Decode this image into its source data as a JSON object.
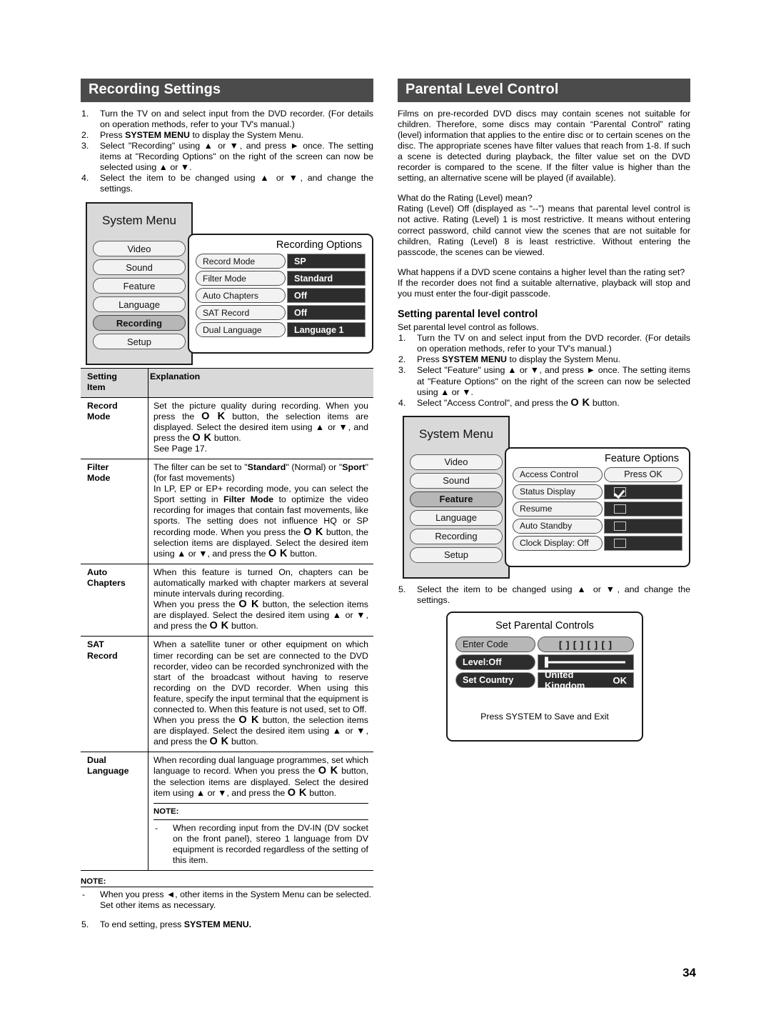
{
  "page_number": "34",
  "left": {
    "section_title": "Recording Settings",
    "steps": [
      {
        "num": "1.",
        "html": "Turn the TV on and select input from the DVD recorder. (For details on operation methods, refer to your TV's manual.)"
      },
      {
        "num": "2.",
        "html": "Press <b>SYSTEM MENU</b> to display the System Menu."
      },
      {
        "num": "3.",
        "html": "Select \"Recording\" using <b>▲</b> or <b>▼</b>, and press <b>►</b> once. The setting items at \"Recording Options\" on the right of the screen can now be selected using <b>▲</b> or <b>▼</b>."
      },
      {
        "num": "4.",
        "html": "Select the item to be changed using <b>▲</b> or <b>▼</b>, and change the settings."
      }
    ],
    "system_menu": {
      "title": "System Menu",
      "items": [
        "Video",
        "Sound",
        "Feature",
        "Language",
        "Recording",
        "Setup"
      ],
      "selected": "Recording"
    },
    "options_panel": {
      "title": "Recording Options",
      "rows": [
        {
          "label": "Record Mode",
          "value": "SP"
        },
        {
          "label": "Filter Mode",
          "value": "Standard"
        },
        {
          "label": "Auto Chapters",
          "value": "Off"
        },
        {
          "label": "SAT Record",
          "value": "Off"
        },
        {
          "label": "Dual Language",
          "value": "Language 1"
        }
      ]
    },
    "table": {
      "headers": [
        "Setting\nItem",
        "Explanation"
      ],
      "header_col1_line1": "Setting",
      "header_col1_line2": "Item",
      "header_col2": "Explanation",
      "rows": [
        {
          "item_line1": "Record",
          "item_line2": "Mode",
          "explanation_html": "Set the picture quality during recording. When you press the <span class=\"okglyph\">O K</span> button, the selection items are displayed. Select the desired item using <b>▲</b> or <b>▼</b>, and press the <span class=\"okglyph\">O K</span> button.<br>See Page 17."
        },
        {
          "item_line1": "Filter",
          "item_line2": "Mode",
          "explanation_html": "The filter can be set to \"<b>Standard</b>\" (Normal) or \"<b>Sport</b>\" (for fast movements)<br>In LP, EP or EP+ recording mode, you can select the Sport setting in <b>Filter Mode</b> to optimize the video recording for images that contain fast movements, like sports. The setting does not influence HQ or SP recording mode. When you press the <span class=\"okglyph\">O K</span> button, the selection items are displayed. Select the desired item using <b>▲</b> or <b>▼</b>, and press the <span class=\"okglyph\">O K</span> button."
        },
        {
          "item_line1": "Auto",
          "item_line2": "Chapters",
          "explanation_html": "When this feature is turned On, chapters can be automatically marked with chapter markers at several minute intervals during recording.<br>When you press the <span class=\"okglyph\">O K</span> button, the selection items are displayed. Select the desired item using <b>▲</b> or <b>▼</b>, and press the <span class=\"okglyph\">O K</span> button."
        },
        {
          "item_line1": "SAT",
          "item_line2": "Record",
          "explanation_html": "When a satellite tuner or other equipment on which timer recording can be set are connected to the DVD recorder, video can be recorded synchronized with the start of the broadcast without having to reserve recording on the DVD recorder. When using this feature, specify the input terminal that the equipment is connected to. When this feature is not used, set to Off.<br>When you press the <span class=\"okglyph\">O K</span> button, the selection items are displayed. Select the desired item using <b>▲</b> or <b>▼</b>, and press the <span class=\"okglyph\">O K</span> button."
        },
        {
          "item_line1": "Dual",
          "item_line2": "Language",
          "explanation_html": "When recording dual language programmes, set which language to record. When you press the <span class=\"okglyph\">O K</span> button, the selection items are displayed. Select the desired item using <b>▲</b> or <b>▼</b>, and press the <span class=\"okglyph\">O K</span> button.",
          "note_label": "NOTE:",
          "note_dash": "-",
          "note_text": "When recording input from the DV-IN (DV socket on the front panel), stereo 1 language from DV equipment is recorded regardless of the setting of this item."
        }
      ]
    },
    "bottom_note": {
      "label": "NOTE:",
      "dash": "-",
      "text_html": "When you press <b>◄</b>, other items in the System Menu can be selected.<br>Set other items as necessary."
    },
    "final_step": {
      "num": "5.",
      "html": "To end setting, press <b>SYSTEM MENU.</b>"
    }
  },
  "right": {
    "section_title": "Parental Level Control",
    "intro": "Films on pre-recorded DVD discs may contain scenes not suitable for children. Therefore, some discs may contain “Parental Control” rating (level) information that applies to the entire disc or to certain scenes on the disc. The appropriate scenes have filter values that reach from 1-8. If such a scene is detected during playback, the filter value set on the DVD recorder is compared to the scene. If the filter value is higher than the setting, an alternative scene will be played (if available).",
    "q1": "What do the Rating (Level) mean?",
    "a1": "Rating (Level) Off (displayed as “--”) means that parental level control is not active. Rating (Level) 1 is most restrictive. It means without entering correct password, child cannot view the scenes that are not suitable for children, Rating (Level) 8 is least restrictive. Without entering the passcode, the scenes can be viewed.",
    "q2": "What happens if a DVD scene contains a higher level than the rating set?",
    "a2": "If the recorder does not find a suitable alternative, playback will stop and you must enter the four-digit passcode.",
    "sub_head": "Setting parental level control",
    "sub_intro": "Set parental level control as follows.",
    "steps": [
      {
        "num": "1.",
        "html": "Turn the TV on and select input from the DVD recorder. (For details on operation methods, refer to your TV's manual.)"
      },
      {
        "num": "2.",
        "html": "Press <b>SYSTEM MENU</b> to display the System Menu."
      },
      {
        "num": "3.",
        "html": "Select \"Feature\" using <b>▲</b> or <b>▼</b>, and press <b>►</b> once. The setting items at \"Feature Options\" on the right of the screen can now be selected using <b>▲</b> or <b>▼</b>."
      },
      {
        "num": "4.",
        "html": "Select \"Access Control\", and press the <span class=\"okglyph\">O K</span> button."
      }
    ],
    "system_menu": {
      "title": "System Menu",
      "items": [
        "Video",
        "Sound",
        "Feature",
        "Language",
        "Recording",
        "Setup"
      ],
      "selected": "Feature"
    },
    "options_panel": {
      "title": "Feature Options",
      "rows": [
        {
          "label": "Access Control",
          "value": "Press OK",
          "type": "pill"
        },
        {
          "label": "Status Display",
          "value": "",
          "type": "checkbox",
          "checked": true
        },
        {
          "label": "Resume",
          "value": "",
          "type": "checkbox",
          "checked": false
        },
        {
          "label": "Auto Standby",
          "value": "",
          "type": "checkbox",
          "checked": false
        },
        {
          "label": "Clock Display: Off",
          "value": "",
          "type": "checkbox",
          "checked": false
        }
      ]
    },
    "step5": {
      "num": "5.",
      "html": "Select the item to be changed using <b>▲</b> or <b>▼</b>, and change the settings."
    },
    "parental_dialog": {
      "title": "Set Parental Controls",
      "rows": [
        {
          "key": "Enter Code",
          "value": "[ ] [ ] [ ] [ ]",
          "style": "light"
        },
        {
          "key": "Level:Off",
          "value": "",
          "style": "slider"
        },
        {
          "key": "Set Country",
          "value": "United Kingdom",
          "value2": "OK",
          "style": "country"
        }
      ],
      "footer": "Press SYSTEM to Save and Exit"
    }
  }
}
